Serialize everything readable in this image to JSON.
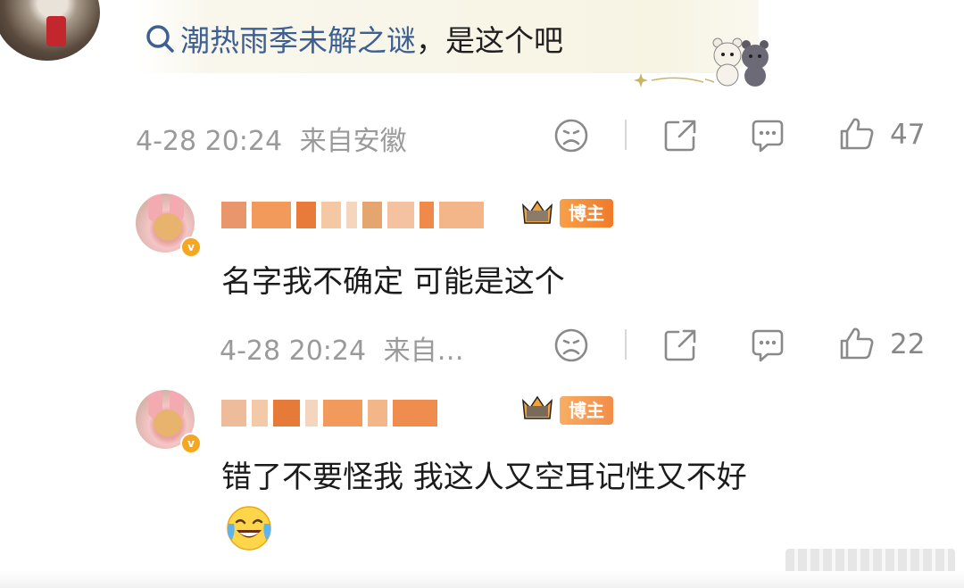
{
  "top_comment": {
    "topic_text": "潮热雨季未解之谜",
    "rest_text": "，是这个吧",
    "date": "4-28 20:24",
    "location": "来自安徽",
    "like_count": "47"
  },
  "replies": [
    {
      "badge": "博主",
      "text": "名字我不确定 可能是这个",
      "date": "4-28 20:24",
      "location": "来自…",
      "like_count": "22"
    },
    {
      "badge": "博主",
      "text": "错了不要怪我 我这人又空耳记性又不好",
      "emoji_icon": "laughing-crying-emoji-icon"
    }
  ],
  "colors": {
    "topic_link": "#3d5f92",
    "meta_gray": "#9a9a9a",
    "host_badge": "#f28a35",
    "verify_badge": "#f6a623"
  }
}
